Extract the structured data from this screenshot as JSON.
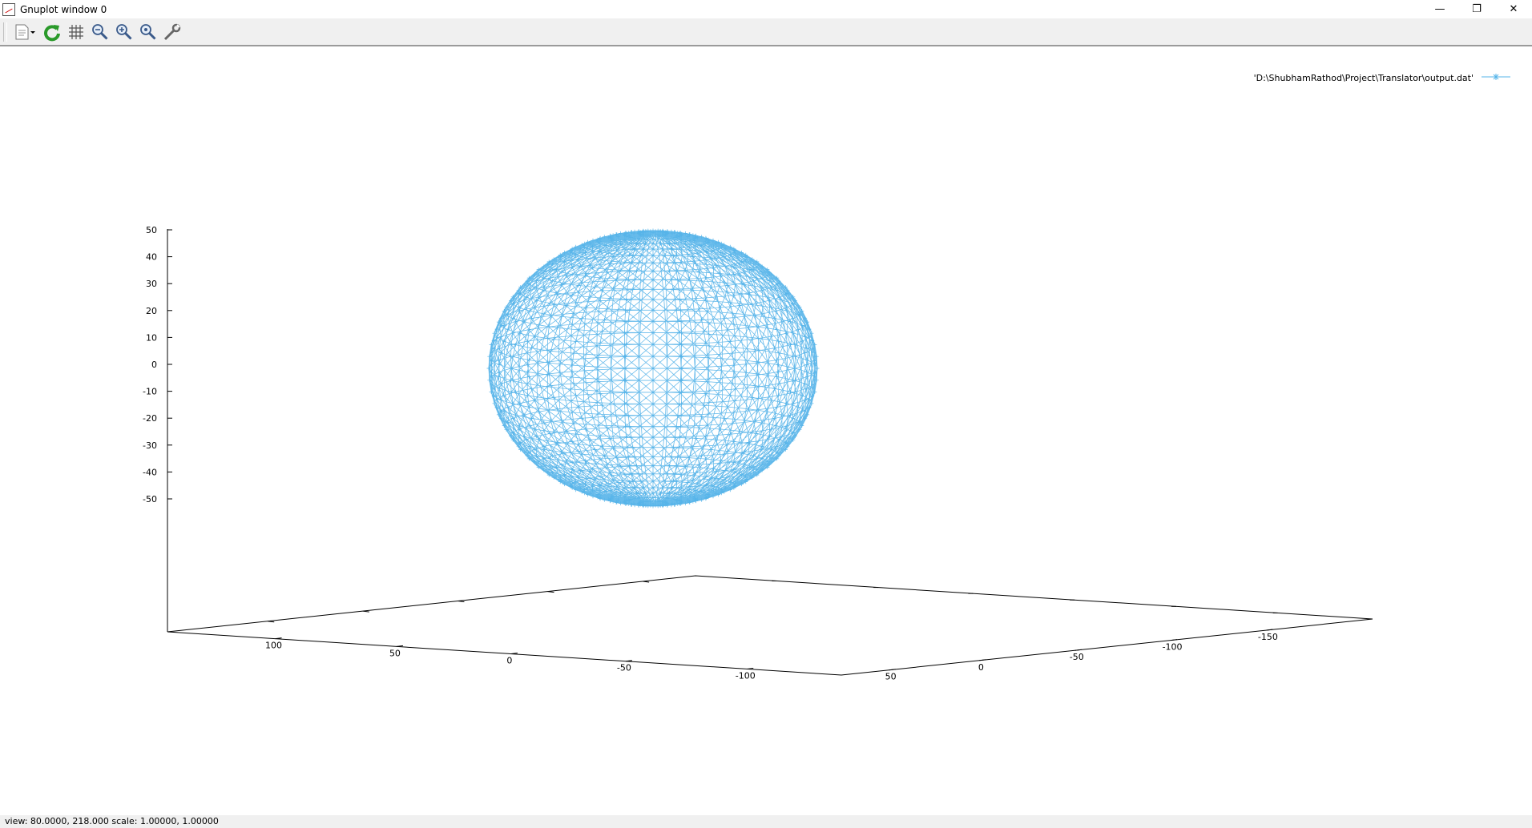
{
  "window": {
    "title": "Gnuplot window 0",
    "controls": {
      "minimize": "—",
      "restore": "❐",
      "close": "✕"
    }
  },
  "toolbar": {
    "buttons": [
      {
        "name": "copy-print-menu",
        "icon": "document-icon"
      },
      {
        "name": "replot",
        "icon": "refresh-icon"
      },
      {
        "name": "toggle-grid",
        "icon": "grid-icon"
      },
      {
        "name": "previous-zoom",
        "icon": "zoom-out-icon"
      },
      {
        "name": "next-zoom",
        "icon": "zoom-in-icon"
      },
      {
        "name": "autoscale",
        "icon": "zoom-fit-icon"
      },
      {
        "name": "options",
        "icon": "wrench-icon"
      }
    ]
  },
  "chart_data": {
    "type": "scatter",
    "subtype": "3d-wireframe-sphere",
    "legend": {
      "label": "'D:\\ShubhamRathod\\Project\\Translator\\output.dat'",
      "placement": "top-right",
      "color": "#56b4e9"
    },
    "series": [
      {
        "name": "'D:\\ShubhamRathod\\Project\\Translator\\output.dat'",
        "shape": "sphere",
        "center": [
          0,
          0,
          0
        ],
        "radius": 50
      }
    ],
    "z_ticks": [
      "50",
      "40",
      "30",
      "20",
      "10",
      "0",
      "-10",
      "-20",
      "-30",
      "-40",
      "-50"
    ],
    "x_ticks": [
      "100",
      "50",
      "0",
      "-50",
      "-100"
    ],
    "y_ticks": [
      "50",
      "0",
      "-50",
      "-100",
      "-150"
    ],
    "zlim": [
      -50,
      50
    ],
    "series_color": "#56b4e9",
    "grid": false
  },
  "status": {
    "text": "view: 80.0000, 218.000   scale: 1.00000, 1.00000"
  }
}
